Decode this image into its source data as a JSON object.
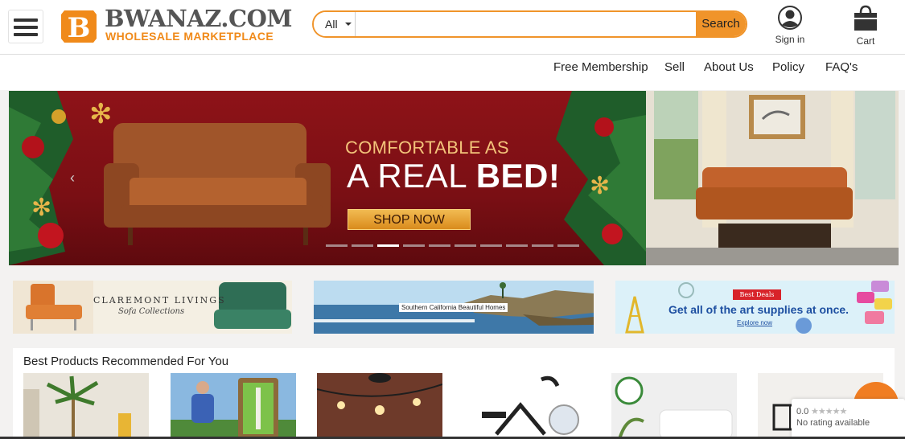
{
  "brand": {
    "name": "BWANAZ.COM",
    "tagline": "WHOLESALE MARKETPLACE",
    "badge_letter": "B",
    "accent_color": "#f0942a"
  },
  "search": {
    "category": "All",
    "value": "",
    "placeholder": "",
    "button_label": "Search"
  },
  "account": {
    "signin_label": "Sign in",
    "cart_label": "Cart"
  },
  "nav": {
    "items": [
      "Free Membership",
      "Sell",
      "About Us",
      "Policy",
      "FAQ's"
    ]
  },
  "hero": {
    "headline_1": "COMFORTABLE AS",
    "headline_2_prefix": "A REAL ",
    "headline_2_bold": "BED!",
    "cta_label": "SHOP NOW",
    "slide_count": 10,
    "active_slide": 3
  },
  "promos": {
    "claremont_title": "CLAREMONT LIVINGS",
    "claremont_sub": "Sofa Collections",
    "socal_caption": "Southern California Beautiful Homes",
    "art_badge": "Best Deals",
    "art_title": "Get all of the art supplies at once.",
    "art_link": "Explore now"
  },
  "products": {
    "title": "Best Products Recommended For You",
    "items": [
      {
        "icon": "palm-villa-image"
      },
      {
        "icon": "golfer-mat-image"
      },
      {
        "icon": "string-lights-image"
      },
      {
        "icon": "exercise-bike-image"
      },
      {
        "icon": "pillow-image"
      },
      {
        "icon": "chandelier-image"
      }
    ]
  },
  "rating_widget": {
    "score": "0.0",
    "stars": "★★★★★",
    "text": "No rating available"
  }
}
